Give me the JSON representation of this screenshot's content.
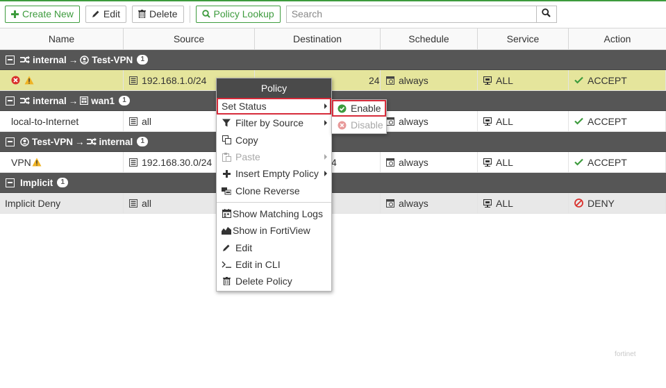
{
  "toolbar": {
    "create_new": "Create New",
    "edit": "Edit",
    "delete": "Delete",
    "policy_lookup": "Policy Lookup",
    "search_placeholder": "Search"
  },
  "columns": [
    "Name",
    "Source",
    "Destination",
    "Schedule",
    "Service",
    "Action"
  ],
  "groups": [
    {
      "from": "internal",
      "to": "Test-VPN",
      "count": "1",
      "rows": [
        {
          "name": "",
          "source": "192.168.1.0/24",
          "destination": "24",
          "schedule": "always",
          "service": "ALL",
          "action": "ACCEPT"
        }
      ]
    },
    {
      "from": "internal",
      "to": "wan1",
      "count": "1",
      "rows": [
        {
          "name": "local-to-Internet",
          "source": "all",
          "destination": "",
          "schedule": "always",
          "service": "ALL",
          "action": "ACCEPT"
        }
      ]
    },
    {
      "from": "Test-VPN",
      "to": "internal",
      "count": "1",
      "rows": [
        {
          "name": "VPN",
          "source": "192.168.30.0/24",
          "destination": "4",
          "schedule": "always",
          "service": "ALL",
          "action": "ACCEPT"
        }
      ]
    },
    {
      "label": "Implicit",
      "count": "1",
      "rows": [
        {
          "name": "Implicit Deny",
          "source": "all",
          "destination": "",
          "schedule": "always",
          "service": "ALL",
          "action": "DENY"
        }
      ]
    }
  ],
  "arrow": "→",
  "context_menu": {
    "title": "Policy",
    "items": {
      "set_status": "Set Status",
      "filter_by_source": "Filter by Source",
      "copy": "Copy",
      "paste": "Paste",
      "insert_empty_policy": "Insert Empty Policy",
      "clone_reverse": "Clone Reverse",
      "show_matching_logs": "Show Matching Logs",
      "show_in_fortiview": "Show in FortiView",
      "edit": "Edit",
      "edit_in_cli": "Edit in CLI",
      "delete_policy": "Delete Policy"
    },
    "submenu": {
      "enable": "Enable",
      "disable": "Disable"
    }
  },
  "watermark": "fortinet",
  "colors": {
    "accent_green": "#3d9b3d",
    "highlight_red": "#d62b3a",
    "selected_row": "#e5e59c",
    "group_header": "#565656",
    "deny_red": "#d9302c"
  }
}
